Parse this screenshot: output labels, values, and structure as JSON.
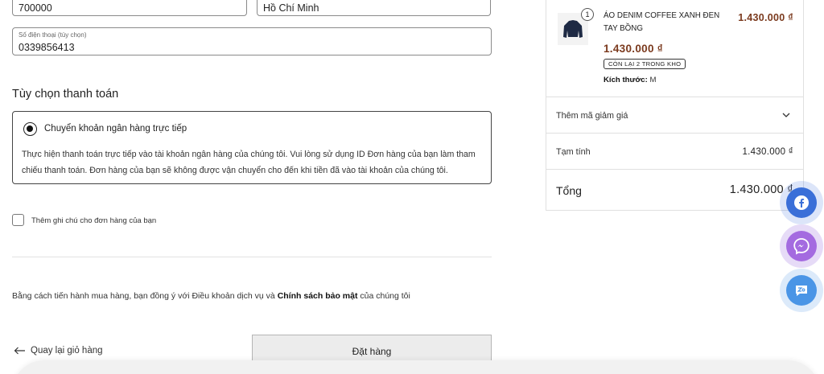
{
  "shipping": {
    "zip_value": "700000",
    "city_value": "Hồ Chí Minh",
    "phone_label": "Số điện thoại (tùy chọn)",
    "phone_value": "0339856413"
  },
  "payment": {
    "section_title": "Tùy chọn thanh toán",
    "method_name": "Chuyển khoản ngân hàng trực tiếp",
    "method_desc": "Thực hiện thanh toán trực tiếp vào tài khoản ngân hàng của chúng tôi. Vui lòng sử dụng ID Đơn hàng của bạn làm tham chiếu thanh toán. Đơn hàng của bạn sẽ không được vận chuyển cho đến khi tiền đã vào tài khoản của chúng tôi."
  },
  "note": {
    "checkbox_label": "Thêm ghi chú cho đơn hàng của bạn"
  },
  "terms": {
    "prefix": "Bằng cách tiến hành mua hàng, bạn đồng ý với Điều khoản dịch vụ và ",
    "privacy_link": "Chính sách bảo mật",
    "suffix": " của chúng tôi"
  },
  "actions": {
    "back_label": "Quay lại giỏ hàng",
    "order_label": "Đặt hàng"
  },
  "summary": {
    "item": {
      "quantity": "1",
      "name": "ÁO DENIM COFFEE XANH ĐEN TAY BỒNG",
      "price_total": "1.430.000 ₫",
      "price": "1.430.000 ₫",
      "stock_badge": "CÒN LẠI 2 TRONG KHO",
      "size_label": "Kích thước:",
      "size_value": "M"
    },
    "discount_label": "Thêm mã giảm giá",
    "subtotal_label": "Tạm tính",
    "subtotal_value": "1.430.000 ₫",
    "total_label": "Tổng",
    "total_value": "1.430.000 ₫"
  },
  "colors": {
    "price": "#7b3a1e",
    "facebook": "#3a6fd8",
    "messenger": "#a46be0",
    "zalo": "#4a95e6"
  }
}
